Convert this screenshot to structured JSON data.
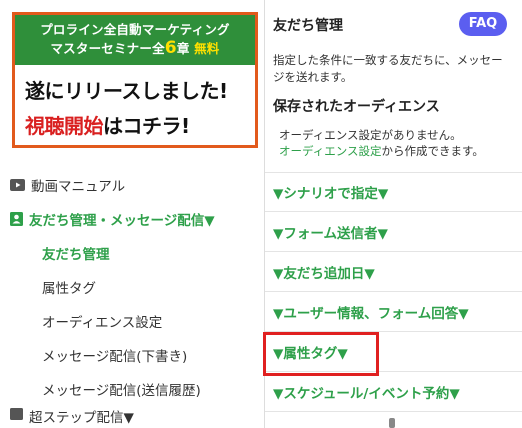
{
  "banner": {
    "top_line1": "プロライン全自動マーケティング",
    "top_line2_prefix": "マスターセミナー全",
    "top_line2_number": "6",
    "top_line2_suffix": "章",
    "top_line2_free": "無料",
    "line1": "遂にリリースしました!",
    "line2_red": "視聴開始",
    "line2_black": "はコチラ!"
  },
  "sidebar": {
    "video_manual": "動画マニュアル",
    "friends_group": "友だち管理・メッセージ配信▼",
    "sub_items": [
      {
        "label": "友だち管理",
        "active": true
      },
      {
        "label": "属性タグ",
        "active": false
      },
      {
        "label": "オーディエンス設定",
        "active": false
      },
      {
        "label": "メッセージ配信(下書き)",
        "active": false
      },
      {
        "label": "メッセージ配信(送信履歴)",
        "active": false
      }
    ],
    "next_group_partial": "超ステップ配信▼"
  },
  "main": {
    "title": "友だち管理",
    "faq": "FAQ",
    "description": "指定した条件に一致する友だちに、メッセージを送れます。",
    "saved_title": "保存されたオーディエンス",
    "empty_text_1": "オーディエンス設定がありません。",
    "empty_link": "オーディエンス設定",
    "empty_text_2": "から作成できます。",
    "filters": [
      "▼シナリオで指定▼",
      "▼フォーム送信者▼",
      "▼友だち追加日▼",
      "▼ユーザー情報、フォーム回答▼",
      "▼属性タグ▼",
      "▼スケジュール/イベント予約▼"
    ]
  },
  "colors": {
    "accent_green": "#2ea04a",
    "faq_purple": "#5b5ef0",
    "highlight_red": "#e02020",
    "banner_border": "#e25a1c"
  }
}
